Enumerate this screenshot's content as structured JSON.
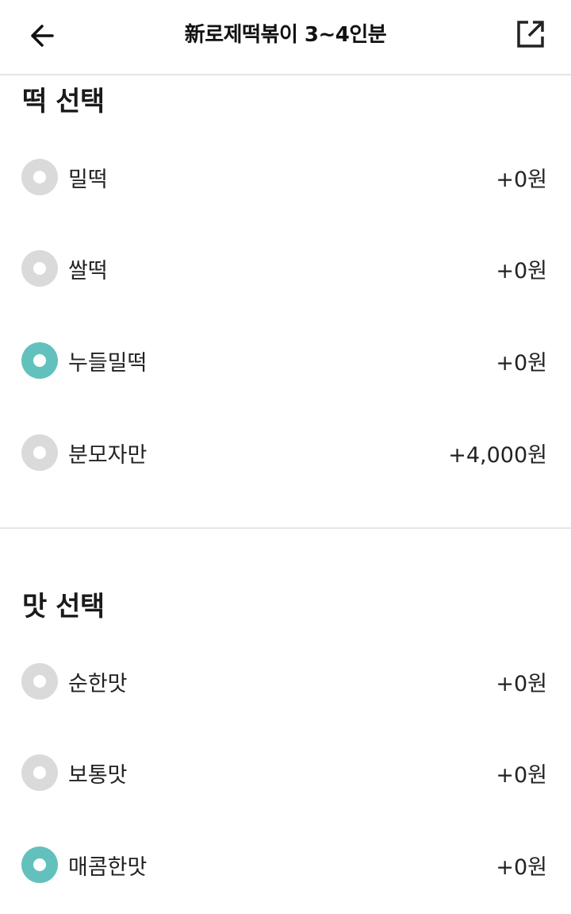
{
  "header": {
    "title": "新로제떡볶이 3~4인분"
  },
  "sections": [
    {
      "title": "떡 선택",
      "options": [
        {
          "label": "밀떡",
          "price": "+0원",
          "selected": false
        },
        {
          "label": "쌀떡",
          "price": "+0원",
          "selected": false
        },
        {
          "label": "누들밀떡",
          "price": "+0원",
          "selected": true
        },
        {
          "label": "분모자만",
          "price": "+4,000원",
          "selected": false
        }
      ]
    },
    {
      "title": "맛 선택",
      "options": [
        {
          "label": "순한맛",
          "price": "+0원",
          "selected": false
        },
        {
          "label": "보통맛",
          "price": "+0원",
          "selected": false
        },
        {
          "label": "매콤한맛",
          "price": "+0원",
          "selected": true
        }
      ]
    }
  ],
  "colors": {
    "accent": "#62c1bd",
    "radio_unselected": "#dadada",
    "divider": "#e6e6e6"
  },
  "icons": {
    "back": "arrow-left-icon",
    "share": "share-external-icon"
  }
}
